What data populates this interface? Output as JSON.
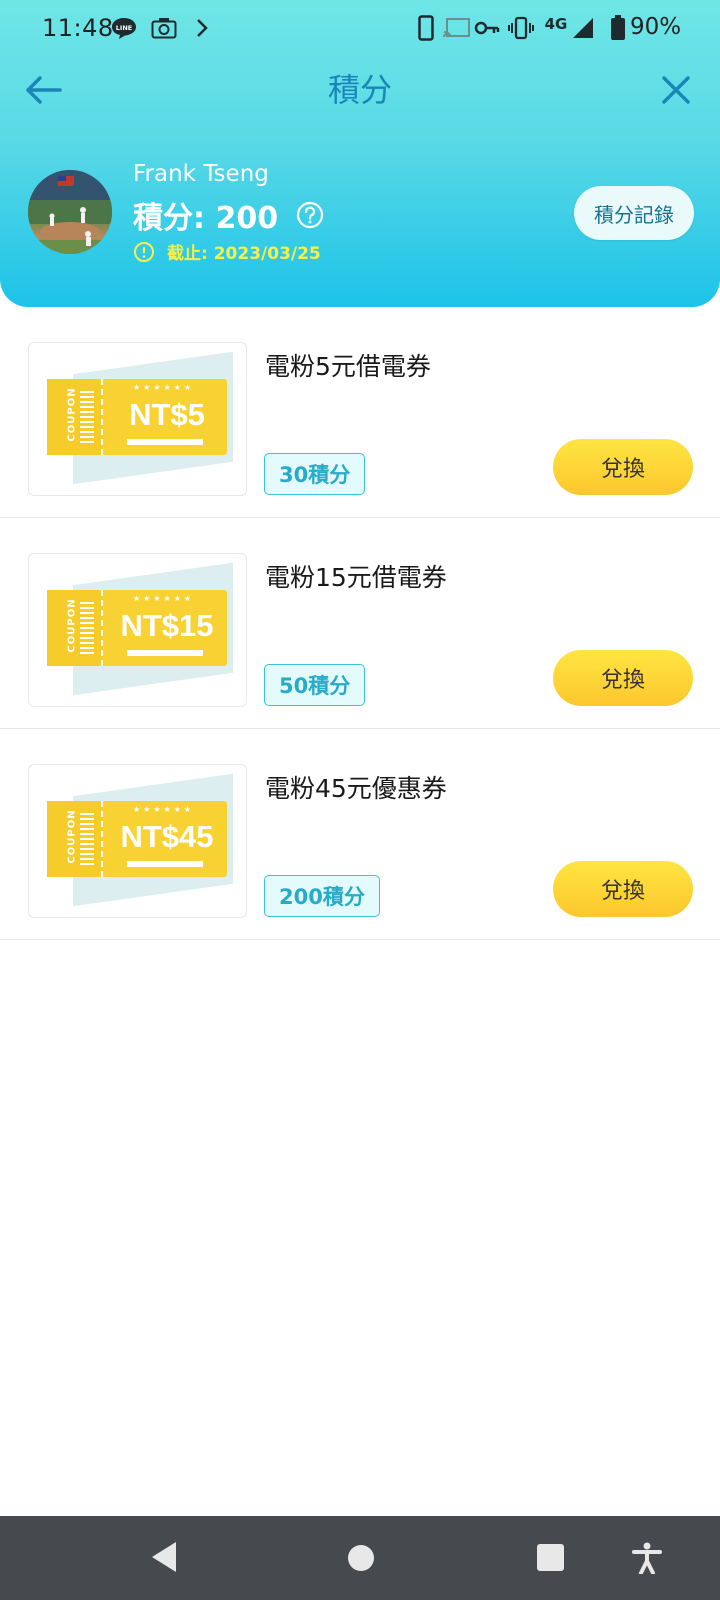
{
  "status_bar": {
    "time": "11:48",
    "network": "4G",
    "battery": "90%",
    "icons": [
      "line-icon",
      "camera-icon",
      "chevron-right-icon",
      "phone-icon",
      "cast-icon",
      "key-icon",
      "vibrate-icon",
      "signal-icon",
      "battery-icon"
    ]
  },
  "topbar": {
    "title": "積分",
    "back_icon": "arrow-left-icon",
    "close_icon": "close-icon"
  },
  "profile": {
    "name": "Frank Tseng",
    "points_label": "積分: 200",
    "expiry": "截止: 2023/03/25",
    "record_button": "積分記錄"
  },
  "rewards": [
    {
      "title": "電粉5元借電券",
      "cost": "30積分",
      "coupon_value": "NT$5",
      "button": "兌換"
    },
    {
      "title": "電粉15元借電券",
      "cost": "50積分",
      "coupon_value": "NT$15",
      "button": "兌換"
    },
    {
      "title": "電粉45元優惠券",
      "cost": "200積分",
      "coupon_value": "NT$45",
      "button": "兌換"
    }
  ],
  "coupon_graphic": {
    "word": "COUPON",
    "stars": "★★★★★★"
  },
  "colors": {
    "header_top": "#6fe6e6",
    "header_bottom": "#1dc3e8",
    "accent_blue": "#1a86b8",
    "button_yellow": "#fcc72e",
    "badge_border": "#3cc2d7",
    "expiry_yellow": "#f6f04a",
    "navbar": "#464a4e"
  }
}
